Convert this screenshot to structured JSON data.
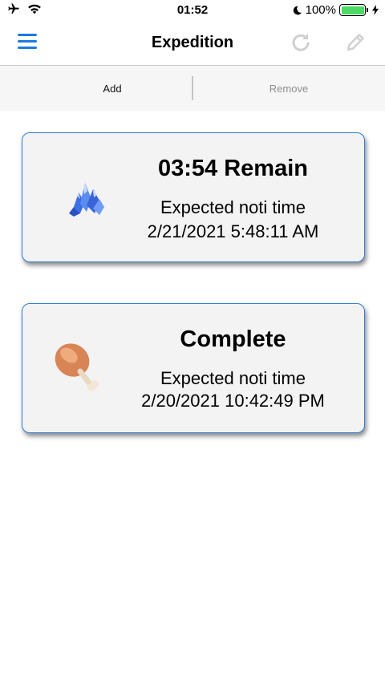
{
  "status_bar": {
    "time": "01:52",
    "battery_percent": "100%",
    "icons": [
      "airplane-icon",
      "wifi-icon",
      "moon-icon",
      "battery-icon",
      "charging-bolt-icon"
    ]
  },
  "nav": {
    "title": "Expedition",
    "icons": [
      "menu-icon",
      "refresh-icon",
      "edit-pencil-icon"
    ],
    "accent_color": "#1a7ae3",
    "disabled_color": "#cfcfcf"
  },
  "segment": {
    "add_label": "Add",
    "remove_label": "Remove"
  },
  "expeditions": [
    {
      "icon": "crystal-icon",
      "status": "03:54 Remain",
      "noti_label": "Expected noti time",
      "noti_time": "2/21/2021 5:48:11 AM"
    },
    {
      "icon": "meat-icon",
      "status": "Complete",
      "noti_label": "Expected noti time",
      "noti_time": "2/20/2021 10:42:49 PM"
    }
  ],
  "colors": {
    "card_border": "#2f7bd8",
    "card_background": "#f3f3f3",
    "battery_fill": "#4cd964"
  }
}
